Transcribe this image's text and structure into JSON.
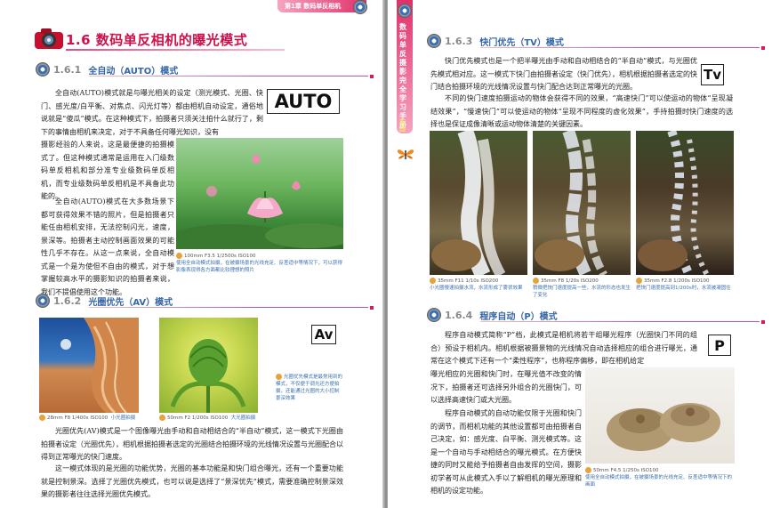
{
  "left": {
    "header_tab": "第1章 数码单反相机",
    "chapter_title": "1.6 数码单反相机的曝光模式",
    "sec_auto": {
      "num": "1.6.1",
      "title": "全自动（AUTO）模式",
      "badge": "AUTO",
      "p1_wide": "全自动(AUTO)模式就是与曝光相关的设定（测光模式、光圈、快门、感光度/白平衡、对焦点、闪光灯等）都由相机自动设定，通俗地说就是“傻瓜”模式。在这种模式下，拍摄者只须关注拍什么就行了，剩下的事情由相机来决定，对于不具备任何曝光知识，没有",
      "p1_narrow": "摄影经验的人来说，这是最便捷的拍摄模式了。但这种模式通常是运用在入门级数码单反相机和部分准专业级数码单反相机，而专业级数码单反相机是不具备此功能的。",
      "p2": "全自动(AUTO)模式在大多数场景下都可获得效果不错的照片，但是拍摄者只能任由相机安排，无法控制闪光，速度，景深等。拍摄者主动控制画面效果的可能性几乎不存在。从这一点来说，全自动模式是一个是为使但不自由的模式，对于想掌握较高水平的摄影知识的拍摄者来说，我们不提倡使用这个功能。",
      "cap_meta": "100mm F3.5 1/2500s ISO100",
      "cap_text": "使用全自动模式拍摄，在被摄场景的光线充足、反差适中等情况下，可以获得影像表现得各方面都比较理想的照片"
    },
    "sec_av": {
      "num": "1.6.2",
      "title": "光圈优先（AV）模式",
      "badge": "Av",
      "cap1_meta": "28mm F8 1/400s ISO100",
      "cap1_text": "小光圈拍摄",
      "cap2_meta": "50mm F2 1/200s ISO100",
      "cap2_text": "大光圈拍摄",
      "side_note": "光圈优先模式是最常用到的模式，不仅便于调光还方便拍摄，还能通过光圈的大小控制景深效果",
      "p1": "光圈优先(AV)模式是一个图像曝光由手动和自动相结合的“半自动”模式，这一模式下光圈由拍摄者设定（光圈优先），相机根据拍摄者选定的光圈结合拍摄环境的光线情况设置与光圈配合以得到正常曝光的快门速度。",
      "p2": "这一模式体现的是光圈的功能优势，光圈的基本功能是和快门组合曝光，还有一个重要功能就是控制景深。选择了光圈优先模式，也可以说是选择了“景深优先”模式，需要准确控制景深效果的摄影者往往选择光圈优先模式。"
    }
  },
  "right": {
    "side_tab": "数码单反摄影完全学习手册",
    "side_tab_accent": "实战",
    "sec_tv": {
      "num": "1.6.3",
      "title": "快门优先（TV）模式",
      "badge": "Tv",
      "p1": "快门优先模式也是一个把半曝光由手动和自动相结合的“半自动”模式，与光圈优先模式相对应。这一模式下快门由拍摄者设定（快门优先），相机根据拍摄者选定的快门结合拍摄环境的光线情况设置与快门配合达到正常曝光的光圈。",
      "p2": "不同的快门速度拍摄运动的物体会获得不同的效果，“高速快门”可以使运动的物体“呈现凝结效果”，“慢速快门”可以使运动的物体“呈现不同程度的虚化效果”，手持拍摄时快门速度的选择也是保证成像清晰或运动物体清楚的关键因素。",
      "cap1_meta": "35mm F11 1/10s ISO200",
      "cap1_text": "小光圈慢速拍摄水流，水流形成了雾状效果",
      "cap2_meta": "35mm F8 1/20s ISO200",
      "cap2_text": "稍微把快门速度提高一些，水流的形态也发生了变化",
      "cap3_meta": "35mm F2.8 1/200s ISO100",
      "cap3_text": "把快门速度提高到1/200s时，水流被凝固住"
    },
    "sec_p": {
      "num": "1.6.4",
      "title": "程序自动（P）模式",
      "badge": "P",
      "p1_wide": "程序自动模式简称“P”档，此模式是相机将若干组曝光程序（光圈快门不同的组合）预设于相机内。相机根据被摄景物的光线情况自动选择相应的组合进行曝光，通常在这个模式下还有一个“柔性程序”，也称程序偏移，即在相机给定",
      "p1_narrow": "曝光相应的光圈和快门时，在曝光值不改变的情况下，拍摄者还可选择另外组合的光圈快门，可以选择高速快门或大光圈。",
      "p2": "程序自动模式的自动功能仅限于光圈和快门的调节，而相机功能的其他设置都可由拍摄者自己决定，如：感光度、白平衡、测光模式等。这是一个自动与手动相结合的曝光模式。在方便快捷的同时又能给予拍摄者自由发挥的空间，摄影初学者可从此模式入手以了解相机的曝光原理和相机的设定功能。",
      "cap_meta": "50mm F4.5 1/250s ISO100",
      "cap_text": "使用全自动模式拍摄，在被摄场景的光线充足、反差适中等情况下的画面"
    }
  },
  "colors": {
    "accent_blue": "#3567a8",
    "accent_red": "#d02050",
    "caption_blue": "#3a6fb0"
  }
}
